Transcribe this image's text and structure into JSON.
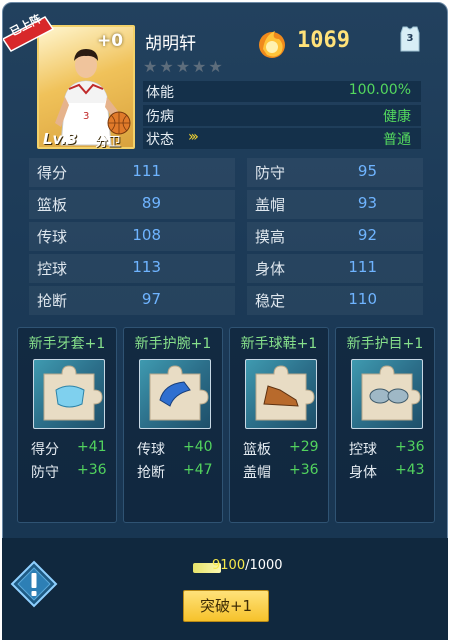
{
  "player": {
    "ribbon": "已上阵",
    "plus": "+0",
    "level": "Lv.3",
    "position": "分卫",
    "name": "胡明轩",
    "stars_filled": 0,
    "stars_total": 5,
    "jersey_number": "3",
    "power": "1069"
  },
  "info": [
    {
      "label": "体能",
      "value": "100.00%"
    },
    {
      "label": "伤病",
      "value": "健康"
    },
    {
      "label": "状态",
      "value": "普通"
    }
  ],
  "stats_left": [
    {
      "label": "得分",
      "value": "111"
    },
    {
      "label": "篮板",
      "value": "89"
    },
    {
      "label": "传球",
      "value": "108"
    },
    {
      "label": "控球",
      "value": "113"
    },
    {
      "label": "抢断",
      "value": "97"
    }
  ],
  "stats_right": [
    {
      "label": "防守",
      "value": "95"
    },
    {
      "label": "盖帽",
      "value": "93"
    },
    {
      "label": "摸高",
      "value": "92"
    },
    {
      "label": "身体",
      "value": "111"
    },
    {
      "label": "稳定",
      "value": "110"
    }
  ],
  "equipment": [
    {
      "name": "新手牙套+1",
      "icon": "mouthguard-icon",
      "bonuses": [
        {
          "label": "得分",
          "value": "+41"
        },
        {
          "label": "防守",
          "value": "+36"
        }
      ]
    },
    {
      "name": "新手护腕+1",
      "icon": "wristband-icon",
      "bonuses": [
        {
          "label": "传球",
          "value": "+40"
        },
        {
          "label": "抢断",
          "value": "+47"
        }
      ]
    },
    {
      "name": "新手球鞋+1",
      "icon": "sneaker-icon",
      "bonuses": [
        {
          "label": "篮板",
          "value": "+29"
        },
        {
          "label": "盖帽",
          "value": "+36"
        }
      ]
    },
    {
      "name": "新手护目+1",
      "icon": "goggles-icon",
      "bonuses": [
        {
          "label": "控球",
          "value": "+36"
        },
        {
          "label": "身体",
          "value": "+43"
        }
      ]
    }
  ],
  "breakthrough": {
    "current": "9100",
    "total": "/1000",
    "button": "突破+1",
    "current_color": "#f6e94a",
    "total_color": "#ffffff"
  },
  "colors": {
    "accent_green": "#53d75e",
    "stat_blue": "#6fb4ff",
    "gold": "#ffe27a",
    "ribbon_red": "#d8282a"
  }
}
